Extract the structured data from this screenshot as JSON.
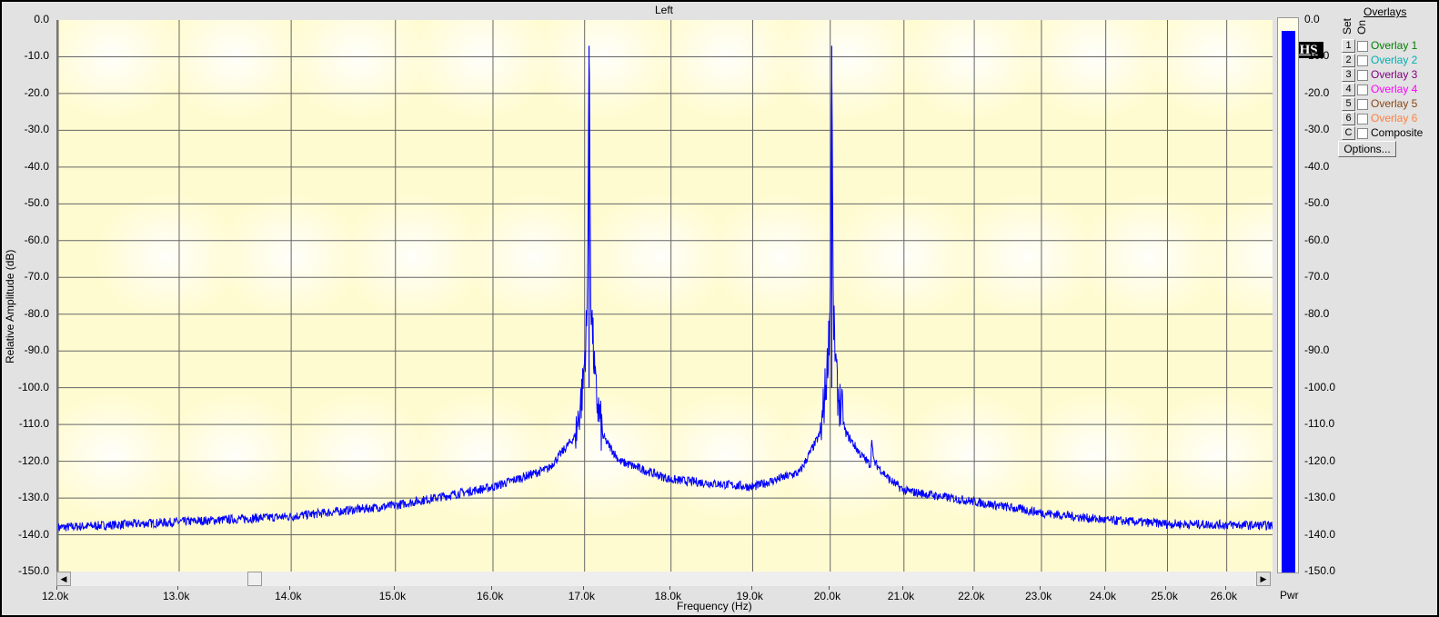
{
  "chart_data": {
    "type": "line",
    "title": "Left",
    "xlabel": "Frequency (Hz)",
    "ylabel": "Relative Amplitude (dB)",
    "xscale": "log",
    "xlim": [
      12000,
      26800
    ],
    "ylim": [
      -150,
      0
    ],
    "grid": true,
    "x_ticks": [
      12000,
      13000,
      14000,
      15000,
      16000,
      17000,
      18000,
      19000,
      20000,
      21000,
      22000,
      23000,
      24000,
      25000,
      26000
    ],
    "x_tick_labels": [
      "12.0k",
      "13.0k",
      "14.0k",
      "15.0k",
      "16.0k",
      "17.0k",
      "18.0k",
      "19.0k",
      "20.0k",
      "21.0k",
      "22.0k",
      "23.0k",
      "24.0k",
      "25.0k",
      "26.0k"
    ],
    "y_tick_labels": [
      "0.0",
      "-10.0",
      "-20.0",
      "-30.0",
      "-40.0",
      "-50.0",
      "-60.0",
      "-70.0",
      "-80.0",
      "-90.0",
      "-100.0",
      "-110.0",
      "-120.0",
      "-130.0",
      "-140.0",
      "-150.0"
    ],
    "series": [
      {
        "name": "Left",
        "color": "#0000ff",
        "x": [
          12000,
          13000,
          14000,
          15000,
          16000,
          16600,
          16900,
          16980,
          17030,
          17050,
          17070,
          17120,
          17200,
          17400,
          18000,
          19000,
          19600,
          19880,
          19960,
          20000,
          20020,
          20040,
          20090,
          20200,
          20400,
          20540,
          20560,
          20580,
          20800,
          21000,
          22000,
          23000,
          24000,
          25000,
          26800
        ],
        "y": [
          -138,
          -136.5,
          -135,
          -132,
          -127,
          -122,
          -113,
          -100,
          -80,
          -7,
          -75,
          -100,
          -113,
          -120,
          -125,
          -127,
          -123,
          -112,
          -95,
          -78,
          -7,
          -80,
          -100,
          -112,
          -118,
          -121,
          -113,
          -120,
          -125,
          -128,
          -131,
          -134,
          -136,
          -137,
          -137.5
        ]
      }
    ]
  },
  "meter": {
    "label": "Pwr",
    "level_db": -3,
    "tick_labels": [
      "0.0",
      "-10.0",
      "-20.0",
      "-30.0",
      "-40.0",
      "-50.0",
      "-60.0",
      "-70.0",
      "-80.0",
      "-90.0",
      "-100.0",
      "-110.0",
      "-120.0",
      "-130.0",
      "-140.0",
      "-150.0"
    ]
  },
  "logo": "PHS",
  "overlays": {
    "title": "Overlays",
    "set_label": "Set",
    "on_label": "On",
    "items": [
      {
        "set": "1",
        "label": "Overlay 1",
        "color": "#008000"
      },
      {
        "set": "2",
        "label": "Overlay 2",
        "color": "#00b0b0"
      },
      {
        "set": "3",
        "label": "Overlay 3",
        "color": "#800080"
      },
      {
        "set": "4",
        "label": "Overlay 4",
        "color": "#ff00ff"
      },
      {
        "set": "5",
        "label": "Overlay 5",
        "color": "#8b4513"
      },
      {
        "set": "6",
        "label": "Overlay 6",
        "color": "#ff8040"
      },
      {
        "set": "C",
        "label": "Composite",
        "color": "#000000"
      }
    ],
    "options_label": "Options..."
  }
}
